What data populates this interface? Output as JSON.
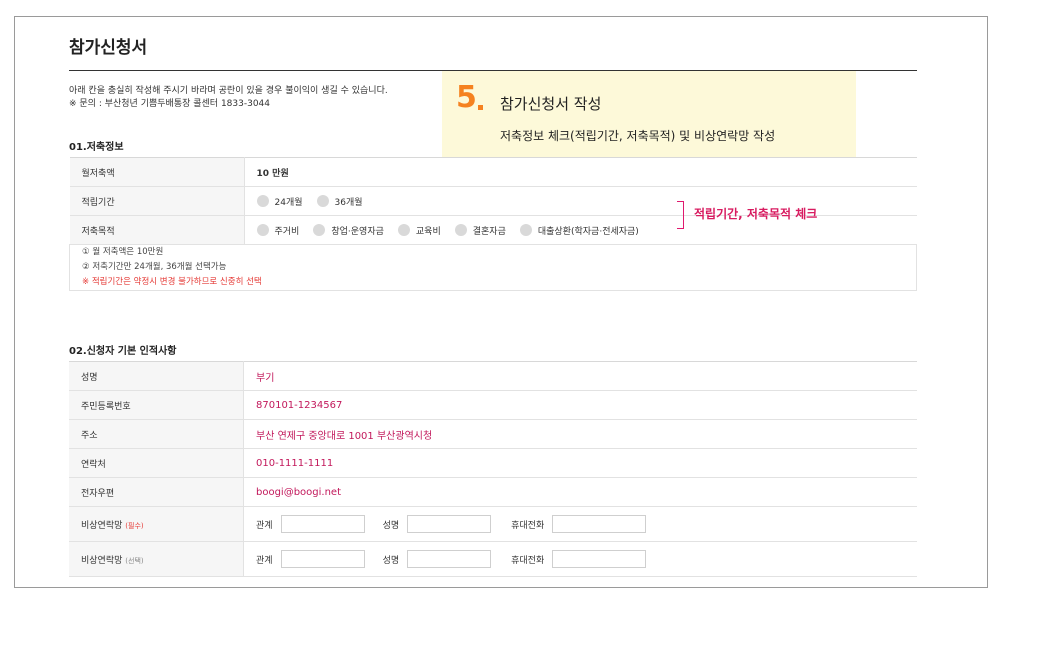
{
  "page": {
    "title": "참가신청서",
    "intro_line1": "아래 칸을 충실히 작성해 주시기 바라며 공란이 있을 경우 불이익이 생길 수 있습니다.",
    "intro_line2": "※ 문의 : 부산청년 기쁨두배통장 콜센터 1833-3044"
  },
  "callout": {
    "number": "5",
    "title": "참가신청서 작성",
    "subtitle": "저축정보 체크(적립기간, 저축목적) 및 비상연락망 작성"
  },
  "annotation": {
    "label": "적립기간, 저축목적 체크",
    "color": "#e0196e"
  },
  "section1": {
    "title": "01.저축정보",
    "monthly_label": "월저축액",
    "monthly_value": "10 만원",
    "period_label": "적립기간",
    "period_options": [
      "24개월",
      "36개월"
    ],
    "purpose_label": "저축목적",
    "purpose_options": [
      "주거비",
      "창업·운영자금",
      "교육비",
      "결혼자금",
      "대출상환(학자금·전세자금)"
    ],
    "notes": [
      "① 월 저축액은 10만원",
      "② 저축기간만 24개월, 36개월 선택가능",
      "※ 적립기간은 약정시 변경 불가하므로 신중히 선택"
    ]
  },
  "section2": {
    "title": "02.신청자 기본 인적사항",
    "rows": [
      {
        "label": "성명",
        "value": "부기"
      },
      {
        "label": "주민등록번호",
        "value": "870101-1234567"
      },
      {
        "label": "주소",
        "value": "부산 연제구 중앙대로 1001 부산광역시청"
      },
      {
        "label": "연락처",
        "value": "010-1111-1111"
      },
      {
        "label": "전자우편",
        "value": "boogi@boogi.net"
      }
    ],
    "emergency": [
      {
        "label": "비상연락망",
        "tag": "(필수)"
      },
      {
        "label": "비상연락망",
        "tag": "(선택)"
      }
    ],
    "emergency_fields": {
      "relation": "관계",
      "name": "성명",
      "phone": "휴대전화"
    }
  },
  "colors": {
    "accent_pink": "#c2185b",
    "callout_bg": "#fdf9d9",
    "number_orange": "#f58220"
  }
}
